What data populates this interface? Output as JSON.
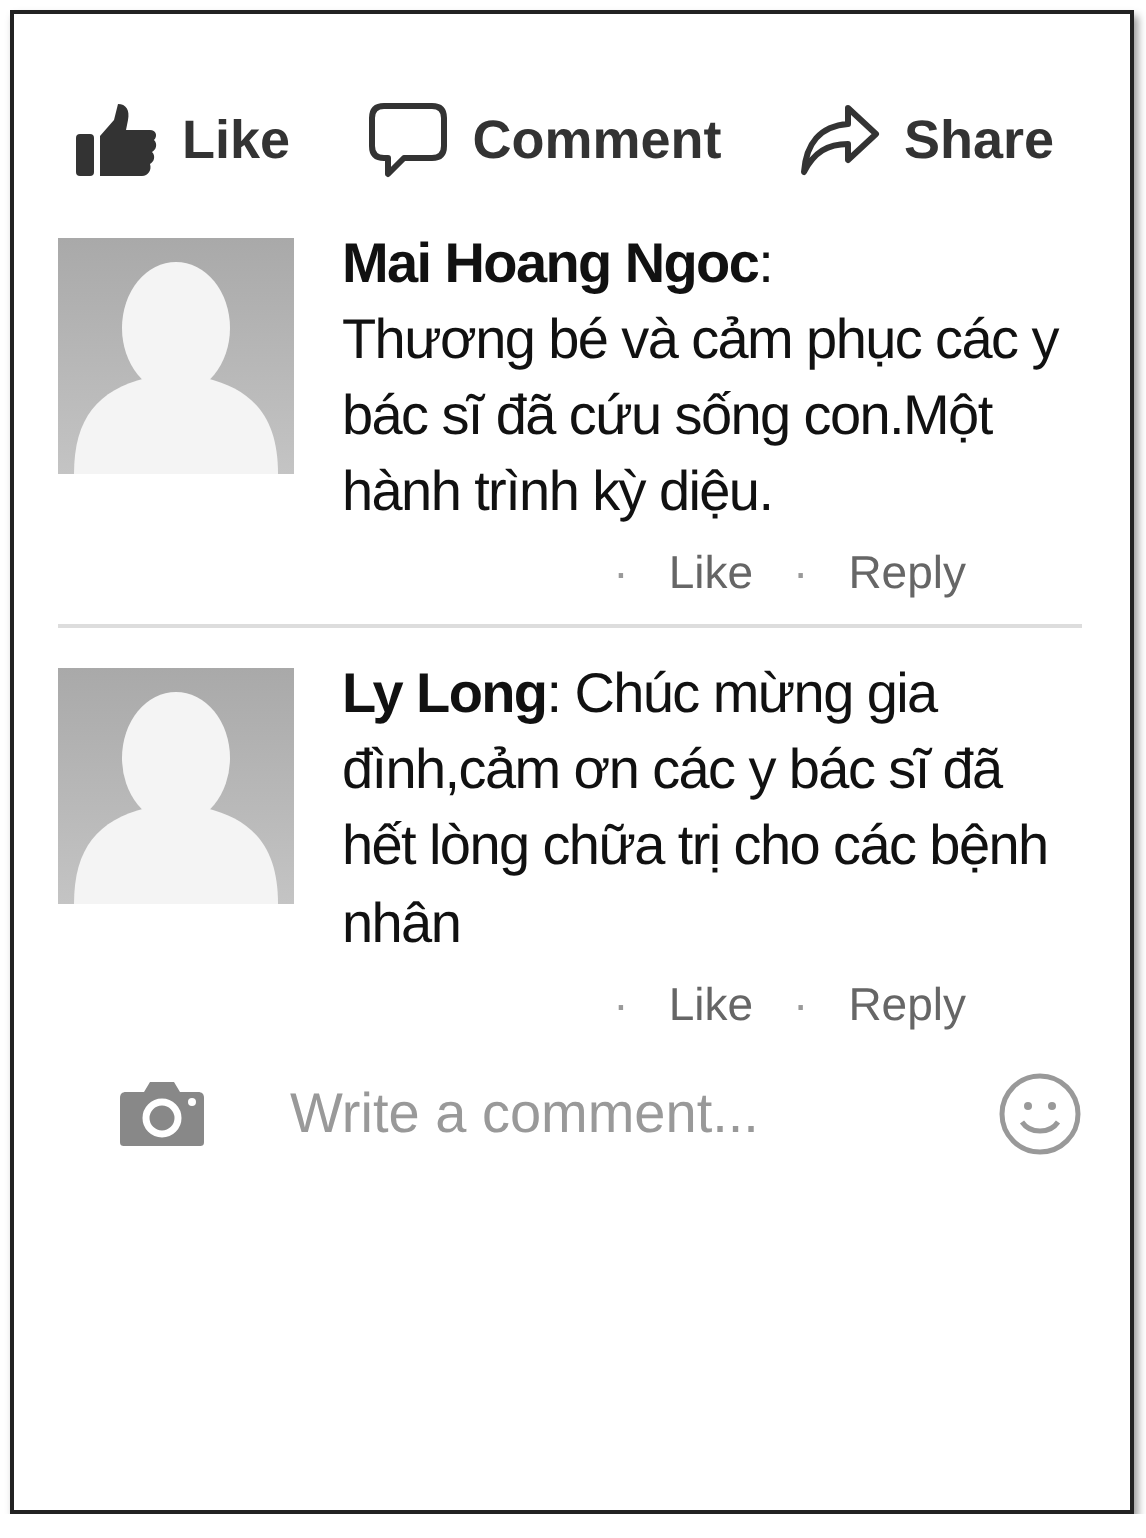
{
  "action_bar": [
    {
      "kind": "like",
      "label": "Like"
    },
    {
      "kind": "comment",
      "label": "Comment"
    },
    {
      "kind": "share",
      "label": "Share"
    }
  ],
  "comments": [
    {
      "text": "**Mai Hoang Ngoc**:\nThương bé và cảm phục các y bác sĩ đã cứu sống con.Một hành trình kỳ diệu.",
      "actions": [
        {
          "separator": "·",
          "label": "Like"
        },
        {
          "separator": "·",
          "label": "Reply"
        }
      ]
    },
    {
      "text": "**Ly Long**: Chúc mừng gia đình,cảm ơn các y bác sĩ đã hết lòng chữa trị cho các bệnh nhân",
      "actions": [
        {
          "separator": "·",
          "label": "Like"
        },
        {
          "separator": "·",
          "label": "Reply"
        }
      ]
    }
  ],
  "composer": {
    "placeholder": "Write a comment..."
  }
}
